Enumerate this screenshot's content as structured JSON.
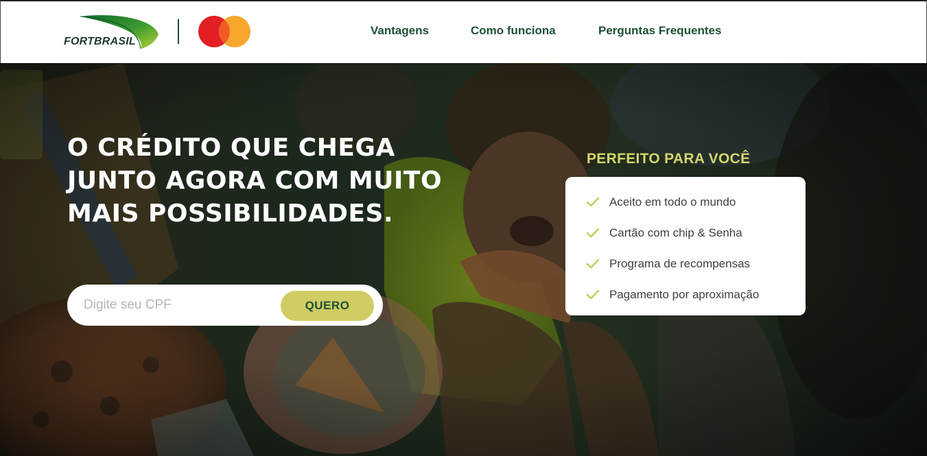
{
  "header": {
    "logo_text": "FORTBRASIL",
    "nav": [
      {
        "label": "Vantagens"
      },
      {
        "label": "Como funciona"
      },
      {
        "label": "Perguntas Frequentes"
      }
    ]
  },
  "hero": {
    "headline": "O CRÉDITO QUE CHEGA JUNTO AGORA COM MUITO MAIS POSSIBILIDADES.",
    "cpf": {
      "placeholder": "Digite seu CPF",
      "value": "",
      "button_label": "QUERO"
    },
    "benefits": {
      "title": "PERFEITO PARA VOCÊ",
      "items": [
        {
          "label": "Aceito em todo o mundo"
        },
        {
          "label": "Cartão com chip & Senha"
        },
        {
          "label": "Programa de recompensas"
        },
        {
          "label": "Pagamento por aproximação"
        }
      ]
    }
  },
  "colors": {
    "brand_green": "#1f4f36",
    "accent_yellow": "#cfcd63",
    "title_yellow": "#d4d56a",
    "mastercard_red": "#e31e25",
    "mastercard_orange": "#f79e1b"
  },
  "icons": [
    "fortbrasil-logo-icon",
    "mastercard-logo-icon",
    "check-icon"
  ]
}
